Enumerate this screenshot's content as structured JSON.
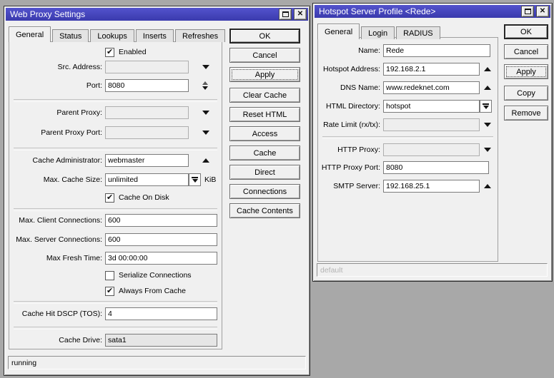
{
  "colors": {
    "desktop_bg": "#a8a8a8",
    "titlebar_blue": "#4343bb",
    "window_bg": "#f0f0f0",
    "status_disabled_text": "#b4b4b4"
  },
  "icons": {
    "close_glyph": "✕",
    "maximize": "maximize-box",
    "chevron_down": "black down triangle",
    "chevron_up": "black up triangle",
    "dropdown_list": "down triangle with bar",
    "spinner": "up-down triangles"
  },
  "web_proxy": {
    "title": "Web Proxy Settings",
    "tabs": [
      "General",
      "Status",
      "Lookups",
      "Inserts",
      "Refreshes"
    ],
    "active_tab": "General",
    "fields": {
      "enabled": {
        "label": "Enabled",
        "checked": true
      },
      "src_address": {
        "label": "Src. Address:",
        "value": ""
      },
      "port": {
        "label": "Port:",
        "value": "8080"
      },
      "parent_proxy": {
        "label": "Parent Proxy:",
        "value": ""
      },
      "parent_proxy_port": {
        "label": "Parent Proxy Port:",
        "value": ""
      },
      "cache_administrator": {
        "label": "Cache Administrator:",
        "value": "webmaster"
      },
      "max_cache_size": {
        "label": "Max. Cache Size:",
        "value": "unlimited",
        "unit": "KiB"
      },
      "cache_on_disk": {
        "label": "Cache On Disk",
        "checked": true
      },
      "max_client_connections": {
        "label": "Max. Client Connections:",
        "value": "600"
      },
      "max_server_connections": {
        "label": "Max. Server Connections:",
        "value": "600"
      },
      "max_fresh_time": {
        "label": "Max Fresh Time:",
        "value": "3d 00:00:00"
      },
      "serialize_connections": {
        "label": "Serialize Connections",
        "checked": false
      },
      "always_from_cache": {
        "label": "Always From Cache",
        "checked": true
      },
      "cache_hit_dscp": {
        "label": "Cache Hit DSCP (TOS):",
        "value": "4"
      },
      "cache_drive": {
        "label": "Cache Drive:",
        "value": "sata1"
      }
    },
    "buttons": [
      "OK",
      "Cancel",
      "Apply",
      "Clear Cache",
      "Reset HTML",
      "Access",
      "Cache",
      "Direct",
      "Connections",
      "Cache Contents"
    ],
    "status_bar": "running"
  },
  "hotspot": {
    "title": "Hotspot Server Profile <Rede>",
    "tabs": [
      "General",
      "Login",
      "RADIUS"
    ],
    "active_tab": "General",
    "fields": {
      "name": {
        "label": "Name:",
        "value": "Rede"
      },
      "hotspot_address": {
        "label": "Hotspot Address:",
        "value": "192.168.2.1"
      },
      "dns_name": {
        "label": "DNS Name:",
        "value": "www.redeknet.com"
      },
      "html_directory": {
        "label": "HTML Directory:",
        "value": "hotspot"
      },
      "rate_limit": {
        "label": "Rate Limit (rx/tx):",
        "value": ""
      },
      "http_proxy": {
        "label": "HTTP Proxy:",
        "value": ""
      },
      "http_proxy_port": {
        "label": "HTTP Proxy Port:",
        "value": "8080"
      },
      "smtp_server": {
        "label": "SMTP Server:",
        "value": "192.168.25.1"
      }
    },
    "buttons": [
      "OK",
      "Cancel",
      "Apply",
      "Copy",
      "Remove"
    ],
    "status_bar": "default"
  }
}
